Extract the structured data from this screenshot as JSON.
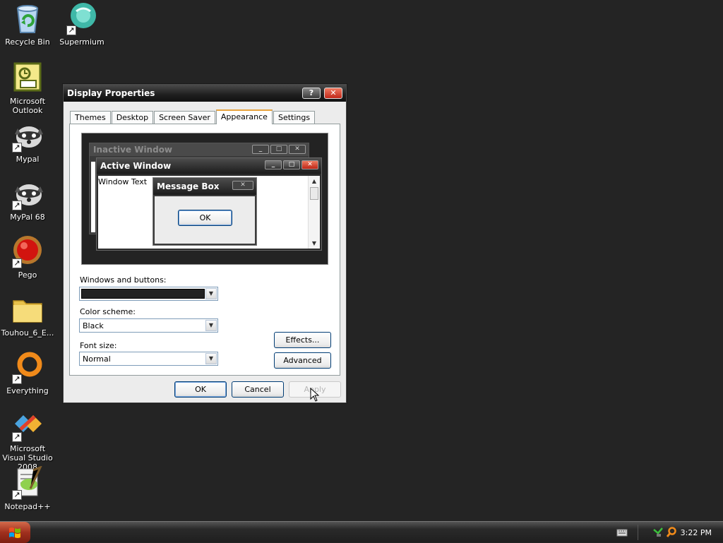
{
  "desktop": {
    "icons": [
      {
        "label": "Recycle Bin",
        "icon": "recycle-bin-icon"
      },
      {
        "label": "Supermium",
        "icon": "supermium-icon"
      },
      {
        "label": "Microsoft Outlook",
        "icon": "outlook-icon"
      },
      {
        "label": "Mypal",
        "icon": "mypal-raccoon-icon"
      },
      {
        "label": "MyPal 68",
        "icon": "mypal-raccoon-icon"
      },
      {
        "label": "Pego",
        "icon": "pego-red-ball-icon"
      },
      {
        "label": "Touhou_6_E...",
        "icon": "folder-icon"
      },
      {
        "label": "Everything",
        "icon": "everything-ring-icon"
      },
      {
        "label": "Microsoft Visual Studio 2008",
        "icon": "visual-studio-icon"
      },
      {
        "label": "Notepad++",
        "icon": "notepadpp-icon"
      }
    ]
  },
  "dialog": {
    "title": "Display Properties",
    "help_label": "?",
    "close_label": "✕",
    "tabs": [
      {
        "label": "Themes",
        "active": false
      },
      {
        "label": "Desktop",
        "active": false
      },
      {
        "label": "Screen Saver",
        "active": false
      },
      {
        "label": "Appearance",
        "active": true
      },
      {
        "label": "Settings",
        "active": false
      }
    ],
    "preview": {
      "inactive_title": "Inactive Window",
      "active_title": "Active Window",
      "window_text": "Window Text",
      "message_box_title": "Message Box",
      "message_box_ok": "OK",
      "minimize_glyph": "_",
      "maximize_glyph": "□",
      "close_glyph": "✕"
    },
    "windows_buttons_label": "Windows and buttons:",
    "color_scheme_label": "Color scheme:",
    "color_scheme_value": "Black",
    "font_size_label": "Font size:",
    "font_size_value": "Normal",
    "effects_button": "Effects...",
    "advanced_button": "Advanced",
    "ok_button": "OK",
    "cancel_button": "Cancel",
    "apply_button": "Apply"
  },
  "taskbar": {
    "clock": "3:22 PM"
  },
  "colors": {
    "desktop": "#242424",
    "title_active": "#1e1e1e",
    "tab_accent": "#e8a33c",
    "close_red": "#c0281a"
  }
}
